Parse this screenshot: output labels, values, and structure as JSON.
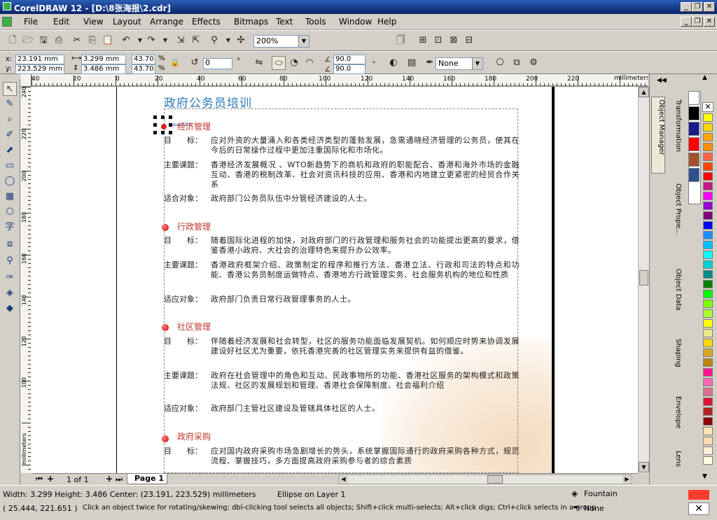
{
  "window": {
    "title": "CorelDRAW 12 - [D:\\8张海报\\2.cdr]",
    "controls": [
      "_",
      "❐",
      "✕"
    ]
  },
  "menu": [
    "File",
    "Edit",
    "View",
    "Layout",
    "Arrange",
    "Effects",
    "Bitmaps",
    "Text",
    "Tools",
    "Window",
    "Help"
  ],
  "menu_mnemonic": [
    "F",
    "E",
    "V",
    "L",
    "A",
    "c",
    "B",
    "T",
    "o",
    "W",
    "H"
  ],
  "standard_toolbar": {
    "zoom_value": "200%"
  },
  "property_bar": {
    "x_label": "x:",
    "x_value": "23.191 mm",
    "y_label": "y:",
    "y_value": "223.529 mm",
    "width_value": "3.299 mm",
    "height_value": "3.486 mm",
    "scale_x": "43.70",
    "scale_y": "43.70",
    "percent": "%",
    "rotation": "0",
    "degree": "°",
    "angle1": "90.0",
    "angle2": "90.0",
    "outline": "None"
  },
  "ruler": {
    "h_ticks": [
      "40",
      "20",
      "0",
      "20",
      "40",
      "60",
      "80",
      "100",
      "120",
      "140",
      "160",
      "180",
      "200",
      "220"
    ],
    "units": "millimeters",
    "v_ticks": [
      "240",
      "220",
      "200",
      "180",
      "160",
      "140",
      "120",
      "100"
    ],
    "v_units": "millimeters"
  },
  "document": {
    "heading": "政府公务员培训",
    "selected_label": "quadrant",
    "sections": [
      {
        "title": "经济管理",
        "rows": [
          {
            "key": "目　　标：",
            "value": "应对外资的大量涌入和各类经济类型的蓬勃发展，急需通晓经济管理的公务员，使其在今后的日常操作过程中更加注重国际化和市场化。"
          },
          {
            "key": "主要课题：",
            "value": "香港经济发展概况 、WTO新趋势下的商机和政府的职能配合、香港和海外市场的金融互动、香港的税制改革、社会对资讯科技的应用、香港和内地建立更紧密的经贸合作关系"
          },
          {
            "key": "适合对象：",
            "value": "政府部门公务员队伍中分管经济建设的人士。"
          }
        ]
      },
      {
        "title": "行政管理",
        "rows": [
          {
            "key": "目　　标：",
            "value": "随着国际化进程的加快，对政府部门的行政管理和服务社会的功能提出更高的要求，借鉴香港小政府、大社会的治理特色来提升办公效率。"
          },
          {
            "key": "主要课题：",
            "value": "香港政府框架介绍、政策制定的程序和推行方法、香港立法、行政和司法的特点和功能、香港公务员制度运做特点、香港地方行政管理实务、社会服务机构的地位和性质"
          },
          {
            "key": "适应对象：",
            "value": "政府部门负责日常行政管理事务的人士。"
          }
        ]
      },
      {
        "title": "社区管理",
        "rows": [
          {
            "key": "目　　标：",
            "value": "伴随着经济发展和社会转型，社区的服务功能面临发展契机。如何顺应时势来协调发展建设好社区尤为重要，依托香港完善的社区管理实务来提供有益的借鉴。"
          },
          {
            "key": "主要课题：",
            "value": "政府在社会管理中的角色和互动、民政事物所的功能、香港社区服务的架构模式和政策法规、社区的发展规划和管理、香港社会保障制度、社会福利介绍"
          },
          {
            "key": "适应对象：",
            "value": "政府部门主管社区建设及管辖具体社区的人士。"
          }
        ]
      },
      {
        "title": "政府采购",
        "rows": [
          {
            "key": "目　　标：",
            "value": "应对国内政府采购市场急剧增长的势头，系统掌握国际通行的政府采购各种方式，规范流程、掌握技巧，多方面提高政府采购参与者的综合素质"
          }
        ]
      }
    ]
  },
  "page_nav": {
    "page_count": "1 of 1",
    "tab": "Page 1"
  },
  "dockers": [
    "Object Manager",
    "Transformation",
    "Object Prope...",
    "Object Data",
    "Shaping",
    "Envelope",
    "Lens"
  ],
  "palette": [
    "#ffffff",
    "#000000",
    "#1a1a8c",
    "#ff0000",
    "#a0522d",
    "#2f4f8f",
    "#ffff00",
    "#ffd700",
    "#ffa500",
    "#ff8c00",
    "#ff6347",
    "#ff4500",
    "#ff0000",
    "#c71585",
    "#ff00ff",
    "#9400d3",
    "#800080",
    "#0000ff",
    "#1e90ff",
    "#00bfff",
    "#00ffff",
    "#00ced1",
    "#008b8b",
    "#008000",
    "#00ff00",
    "#7fff00",
    "#adff2f",
    "#ffff00",
    "#f0e68c",
    "#ffd700",
    "#daa520",
    "#b8860b",
    "#ff1493",
    "#ff69b4",
    "#db7093",
    "#dc143c",
    "#b22222",
    "#8b0000",
    "#ffe4b5",
    "#ffdead",
    "#ffefd5",
    "#ffffe0"
  ],
  "status": {
    "line1": "Width: 3.299  Height: 3.486  Center: (23.191, 223.529)  millimeters",
    "object": "Ellipse on Layer 1",
    "fill_name": "Fountain",
    "line2_coords": "( 25.444, 221.651 )",
    "hint": "Click an object twice for rotating/skewing; dbl-clicking tool selects all objects; Shift+click multi-selects; Alt+click digs; Ctrl+click selects in a group",
    "outline_name": "None",
    "fill_color": "#ff3b2f"
  }
}
